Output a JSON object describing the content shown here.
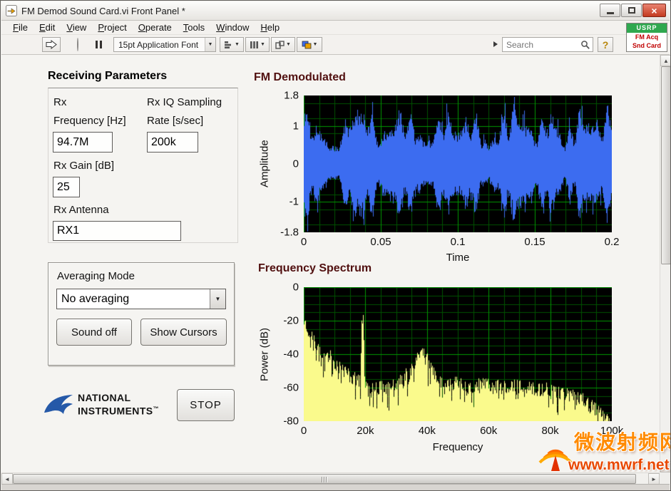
{
  "window": {
    "title": "FM Demod Sound Card.vi Front Panel *"
  },
  "menu": {
    "items": [
      "File",
      "Edit",
      "View",
      "Project",
      "Operate",
      "Tools",
      "Window",
      "Help"
    ]
  },
  "toolbar": {
    "font_selector": "15pt Application Font",
    "search": {
      "placeholder": "Search"
    },
    "help": "?"
  },
  "icons": {
    "dropdown_arrow": "▼",
    "scroll_up": "▲",
    "scroll_down": "▼",
    "scroll_left": "◄",
    "scroll_right": "►",
    "close": "×"
  },
  "vi_icon": {
    "top": "USRP",
    "line1": "FM Acq",
    "line2": "Snd Card"
  },
  "receiving_parameters": {
    "title": "Receiving Parameters",
    "rx_frequency": {
      "label": "Rx\nFrequency [Hz]",
      "value": "94.7M"
    },
    "rx_iq_sampling": {
      "label": "Rx IQ Sampling\nRate [s/sec]",
      "value": "200k"
    },
    "rx_gain": {
      "label": "Rx Gain [dB]",
      "value": "25"
    },
    "rx_antenna": {
      "label": "Rx Antenna",
      "value": "RX1"
    }
  },
  "averaging": {
    "label": "Averaging Mode",
    "selected": "No averaging",
    "sound_button": "Sound off",
    "cursors_button": "Show Cursors"
  },
  "stop_button": "STOP",
  "ni_logo": {
    "line1": "NATIONAL",
    "line2": "INSTRUMENTS",
    "tm": "™"
  },
  "watermark": {
    "site_name": "微波射频网",
    "url": "www.mwrf.net"
  },
  "chart_data": [
    {
      "id": "fm_demodulated",
      "type": "line",
      "title": "FM Demodulated",
      "xlabel": "Time",
      "ylabel": "Amplitude",
      "xlim": [
        0,
        0.2
      ],
      "ylim": [
        -1.8,
        1.8
      ],
      "xticks": [
        {
          "v": 0,
          "label": "0"
        },
        {
          "v": 0.05,
          "label": "0.05"
        },
        {
          "v": 0.1,
          "label": "0.1"
        },
        {
          "v": 0.15,
          "label": "0.15"
        },
        {
          "v": 0.2,
          "label": "0.2"
        }
      ],
      "yticks": [
        {
          "v": 1.8,
          "label": "1.8"
        },
        {
          "v": 1,
          "label": "1"
        },
        {
          "v": 0,
          "label": "0"
        },
        {
          "v": -1,
          "label": "-1"
        },
        {
          "v": -1.8,
          "label": "-1.8"
        }
      ],
      "bg_color": "#000000",
      "plot_color": "#3C6CF0",
      "grid": {
        "x_minor": 0.01,
        "x_major": 0.05,
        "y_minor": 0.4,
        "y_major": 1,
        "minor_color": "#005200",
        "major_color": "#009600"
      },
      "seed": 11,
      "amplitude_envelope": [
        1.65,
        1.1,
        0.45,
        1.5,
        1.7,
        0.8,
        1.55,
        1.35,
        0.6,
        1.6,
        1.05,
        1.5,
        0.55,
        1.45,
        1.7,
        0.95,
        1.6,
        0.7,
        1.55,
        1.25,
        1.6
      ],
      "description": "Dense noisy FM-demodulated audio waveform centered on 0, amplitude beating between about ±0.5 and ±1.8 over 0–0.2 s"
    },
    {
      "id": "frequency_spectrum",
      "type": "area",
      "title": "Frequency Spectrum",
      "xlabel": "Frequency",
      "ylabel": "Power (dB)",
      "xlim": [
        0,
        100000
      ],
      "ylim": [
        -80,
        0
      ],
      "xticks": [
        {
          "v": 0,
          "label": "0"
        },
        {
          "v": 20000,
          "label": "20k"
        },
        {
          "v": 40000,
          "label": "40k"
        },
        {
          "v": 60000,
          "label": "60k"
        },
        {
          "v": 80000,
          "label": "80k"
        },
        {
          "v": 100000,
          "label": "100k"
        }
      ],
      "yticks": [
        {
          "v": 0,
          "label": "0"
        },
        {
          "v": -20,
          "label": "-20"
        },
        {
          "v": -40,
          "label": "-40"
        },
        {
          "v": -60,
          "label": "-60"
        },
        {
          "v": -80,
          "label": "-80"
        }
      ],
      "bg_color": "#000000",
      "plot_color": "#FAFA8C",
      "grid": {
        "x_minor": 5000,
        "x_major": 20000,
        "y_minor": 5,
        "y_major": 20,
        "minor_color": "#005200",
        "major_color": "#009600"
      },
      "seed": 23,
      "envelope_points": [
        [
          0,
          -20
        ],
        [
          1000,
          -24
        ],
        [
          2500,
          -30
        ],
        [
          4000,
          -34
        ],
        [
          6000,
          -38
        ],
        [
          8000,
          -41
        ],
        [
          10000,
          -45
        ],
        [
          12500,
          -49
        ],
        [
          15000,
          -53
        ],
        [
          17000,
          -55
        ],
        [
          18400,
          -56
        ],
        [
          18800,
          -21
        ],
        [
          19300,
          -21
        ],
        [
          19800,
          -56
        ],
        [
          21000,
          -58
        ],
        [
          24000,
          -60
        ],
        [
          28000,
          -59
        ],
        [
          32000,
          -55
        ],
        [
          35000,
          -48
        ],
        [
          37000,
          -41
        ],
        [
          38500,
          -38
        ],
        [
          40000,
          -42
        ],
        [
          42000,
          -50
        ],
        [
          44000,
          -56
        ],
        [
          47000,
          -58
        ],
        [
          50000,
          -57
        ],
        [
          54000,
          -59
        ],
        [
          58000,
          -57
        ],
        [
          62000,
          -60
        ],
        [
          66000,
          -59
        ],
        [
          70000,
          -60
        ],
        [
          74000,
          -60
        ],
        [
          78000,
          -61
        ],
        [
          82000,
          -62
        ],
        [
          86000,
          -64
        ],
        [
          90000,
          -66
        ],
        [
          93000,
          -70
        ],
        [
          96000,
          -75
        ],
        [
          98000,
          -78
        ],
        [
          100000,
          -80
        ]
      ],
      "description": "Noisy FM baseband spectrum: strong audio content falling from ~-20 dB, narrow 19 kHz pilot spike to ~-21 dB, stereo subcarrier hump near 38 kHz at ~-38 dB, ~-60 dB floor declining to -80 dB at 100 kHz"
    }
  ]
}
